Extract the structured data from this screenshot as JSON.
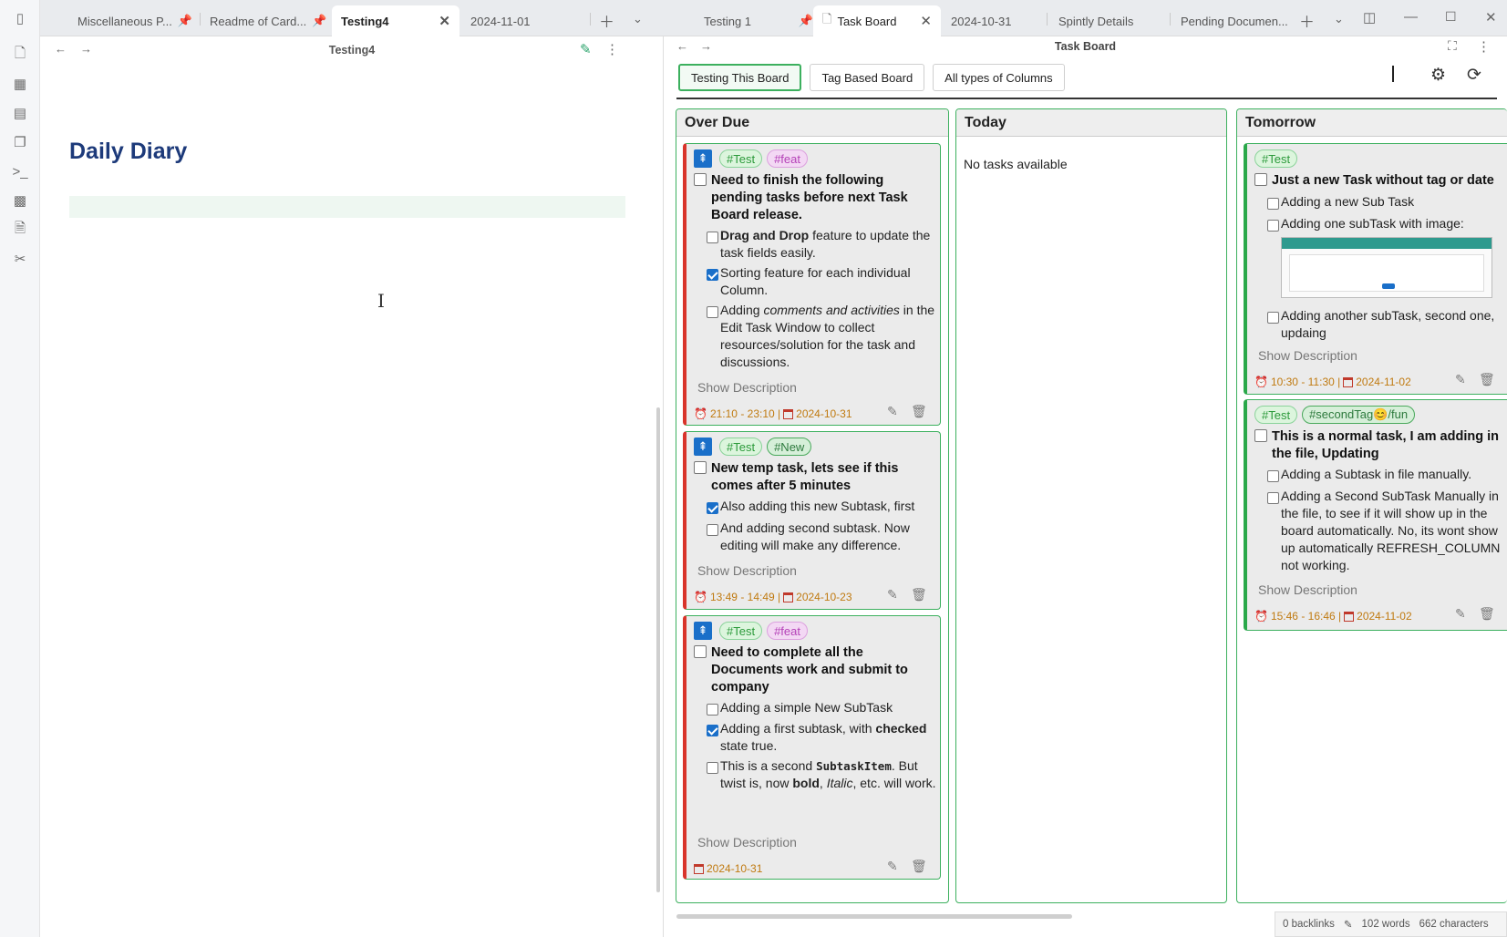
{
  "left_tabs": [
    {
      "label": "Miscellaneous P...",
      "pinned": true
    },
    {
      "label": "Readme of Card...",
      "pinned": true
    },
    {
      "label": "Testing4",
      "active": true
    },
    {
      "label": "2024-11-01"
    }
  ],
  "right_tabs": [
    {
      "label": "Testing 1",
      "pinned": true
    },
    {
      "label": "Task Board",
      "active": true
    },
    {
      "label": "2024-10-31"
    },
    {
      "label": "Spintly Details"
    },
    {
      "label": "Pending Documen..."
    }
  ],
  "left_note": {
    "header_title": "Testing4",
    "heading": "Daily Diary"
  },
  "right_note": {
    "header_title": "Task Board"
  },
  "board": {
    "tabs": [
      "Testing This Board",
      "Tag Based Board",
      "All types of Columns"
    ],
    "active_tab": 0,
    "show_description": "Show Description",
    "columns": [
      {
        "title": "Over Due",
        "tasks": [
          {
            "tags": [
              "#Test",
              "#feat"
            ],
            "title": "Need to finish the following pending tasks before next Task Board release.",
            "subtasks": [
              {
                "bold": "Drag and Drop",
                "text": " feature to update the task fields easily.",
                "checked": false
              },
              {
                "text": "Sorting feature for each individual Column.",
                "checked": true
              },
              {
                "pre": "Adding ",
                "italic": "comments and activities",
                "text": " in the Edit Task Window to collect resources/solution for the task and discussions.",
                "checked": false
              }
            ],
            "time": "21:10 - 23:10 |",
            "date": "2024-10-31"
          },
          {
            "tags": [
              "#Test",
              "#New"
            ],
            "title": "New temp task, lets see if this comes after 5 minutes",
            "subtasks": [
              {
                "text": "Also adding this new Subtask, first",
                "checked": true
              },
              {
                "text": "And adding second subtask. Now editing will make any difference.",
                "checked": false
              }
            ],
            "time": "13:49 - 14:49 |",
            "date": "2024-10-23"
          },
          {
            "tags": [
              "#Test",
              "#feat"
            ],
            "title": "Need to complete all the Documents work and submit to company",
            "subtasks": [
              {
                "text": "Adding a simple New SubTask",
                "checked": false
              },
              {
                "pre": "Adding a first subtask, with ",
                "bold": "checked",
                "text": " state true.",
                "checked": true
              },
              {
                "pre": "This is a second ",
                "code": "SubtaskItem",
                "text": ". But twist is, now ",
                "bold2": "bold",
                "sep": ", ",
                "italic2": "Italic",
                "tail": ", etc. will work.",
                "checked": false
              }
            ],
            "time": "",
            "date": "2024-10-31"
          }
        ]
      },
      {
        "title": "Today",
        "empty_text": "No tasks available",
        "tasks": []
      },
      {
        "title": "Tomorrow",
        "tasks": [
          {
            "tags": [
              "#Test"
            ],
            "title": "Just a new Task without tag or date",
            "subtasks": [
              {
                "text": "Adding a new Sub Task",
                "checked": false
              },
              {
                "text": "Adding one subTask with image:",
                "checked": false
              },
              {
                "text": "Adding another subTask, second one, updaing",
                "checked": false
              }
            ],
            "time": "10:30 - 11:30 |",
            "date": "2024-11-02"
          },
          {
            "tags": [
              "#Test",
              "#secondTag😊/fun"
            ],
            "title": "This is a normal task, I am adding in the file, Updating",
            "subtasks": [
              {
                "text": "Adding a Subtask in file manually.",
                "checked": false
              },
              {
                "text": "Adding a Second SubTask Manually in the file, to see if it will show up in the board automatically. No, its wont show up automatically REFRESH_COLUMN not working.",
                "checked": false
              }
            ],
            "time": "15:46 - 16:46 |",
            "date": "2024-11-02"
          }
        ]
      }
    ]
  },
  "status_bar": {
    "backlinks": "0 backlinks",
    "words": "102 words",
    "characters": "662 characters"
  }
}
